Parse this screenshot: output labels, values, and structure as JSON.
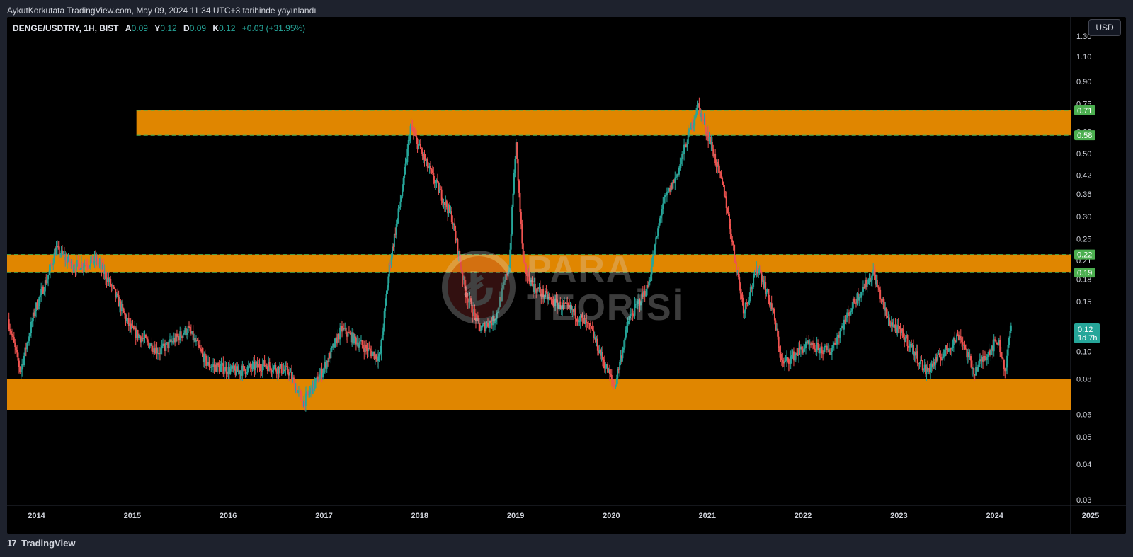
{
  "header": {
    "published_text": "AykutKorkutata TradingView.com, May 09, 2024 11:34 UTC+3 tarihinde yayınlandı"
  },
  "legend": {
    "symbol": "DENGE/USDTRY, 1H, BIST",
    "a_label": "A",
    "a_value": "0.09",
    "y_label": "Y",
    "y_value": "0.12",
    "d_label": "D",
    "d_value": "0.09",
    "k_label": "K",
    "k_value": "0.12",
    "change": "+0.03 (+31.95%)"
  },
  "currency_button": "USD",
  "watermark": {
    "logo_glyph": "₺",
    "line1": "PARA",
    "line2": "TEORİSİ"
  },
  "footer": {
    "logo_mark": "17",
    "brand": "TradingView"
  },
  "colors": {
    "up": "#26a69a",
    "down": "#ef5350",
    "zone": "#ff9800",
    "zone_line": "#4caf50",
    "price_badge": "#26a69a",
    "level_badge": "#4caf50",
    "background": "#000000"
  },
  "chart_data": {
    "type": "candlestick",
    "scale": "log",
    "ylim": [
      0.03,
      1.4
    ],
    "xlim": [
      2013.9,
      2025.0
    ],
    "y_ticks": [
      "1.30",
      "1.10",
      "0.90",
      "0.75",
      "0.60",
      "0.50",
      "0.42",
      "0.36",
      "0.30",
      "0.25",
      "0.21",
      "0.18",
      "0.15",
      "0.12",
      "0.10",
      "0.08",
      "0.06",
      "0.05",
      "0.04",
      "0.03"
    ],
    "x_ticks": [
      "2014",
      "2015",
      "2016",
      "2017",
      "2018",
      "2019",
      "2020",
      "2021",
      "2022",
      "2023",
      "2024",
      "2025"
    ],
    "zones": [
      {
        "top": 0.71,
        "bottom": 0.58,
        "start": 2015.25,
        "label_top": "0.71",
        "label_bottom": "0.58"
      },
      {
        "top": 0.22,
        "bottom": 0.19,
        "start": 2013.9,
        "label_top": "0.22",
        "label_bottom": "0.19"
      },
      {
        "top": 0.08,
        "bottom": 0.062,
        "start": 2013.9
      }
    ],
    "last_price": {
      "value": 0.12,
      "label": "0.12",
      "countdown": "1d 7h"
    },
    "price_path": [
      [
        2013.92,
        0.13
      ],
      [
        2014.05,
        0.085
      ],
      [
        2014.2,
        0.14
      ],
      [
        2014.35,
        0.19
      ],
      [
        2014.42,
        0.23
      ],
      [
        2014.6,
        0.2
      ],
      [
        2014.85,
        0.21
      ],
      [
        2015.0,
        0.17
      ],
      [
        2015.2,
        0.12
      ],
      [
        2015.5,
        0.1
      ],
      [
        2015.8,
        0.12
      ],
      [
        2016.0,
        0.09
      ],
      [
        2016.3,
        0.085
      ],
      [
        2016.6,
        0.09
      ],
      [
        2016.85,
        0.085
      ],
      [
        2017.0,
        0.066
      ],
      [
        2017.2,
        0.085
      ],
      [
        2017.4,
        0.12
      ],
      [
        2017.7,
        0.1
      ],
      [
        2017.8,
        0.095
      ],
      [
        2017.9,
        0.2
      ],
      [
        2018.05,
        0.4
      ],
      [
        2018.12,
        0.62
      ],
      [
        2018.3,
        0.45
      ],
      [
        2018.55,
        0.3
      ],
      [
        2018.7,
        0.16
      ],
      [
        2018.85,
        0.12
      ],
      [
        2019.0,
        0.13
      ],
      [
        2019.15,
        0.2
      ],
      [
        2019.22,
        0.55
      ],
      [
        2019.3,
        0.2
      ],
      [
        2019.4,
        0.17
      ],
      [
        2019.6,
        0.15
      ],
      [
        2019.8,
        0.14
      ],
      [
        2020.0,
        0.12
      ],
      [
        2020.15,
        0.09
      ],
      [
        2020.25,
        0.075
      ],
      [
        2020.4,
        0.13
      ],
      [
        2020.6,
        0.17
      ],
      [
        2020.75,
        0.33
      ],
      [
        2020.9,
        0.42
      ],
      [
        2021.0,
        0.55
      ],
      [
        2021.12,
        0.74
      ],
      [
        2021.25,
        0.55
      ],
      [
        2021.4,
        0.36
      ],
      [
        2021.5,
        0.22
      ],
      [
        2021.6,
        0.14
      ],
      [
        2021.75,
        0.2
      ],
      [
        2021.9,
        0.14
      ],
      [
        2022.0,
        0.09
      ],
      [
        2022.25,
        0.105
      ],
      [
        2022.5,
        0.1
      ],
      [
        2022.75,
        0.15
      ],
      [
        2022.95,
        0.19
      ],
      [
        2023.1,
        0.13
      ],
      [
        2023.3,
        0.11
      ],
      [
        2023.5,
        0.085
      ],
      [
        2023.7,
        0.1
      ],
      [
        2023.85,
        0.115
      ],
      [
        2024.0,
        0.085
      ],
      [
        2024.15,
        0.1
      ],
      [
        2024.25,
        0.11
      ],
      [
        2024.33,
        0.085
      ],
      [
        2024.38,
        0.12
      ]
    ]
  }
}
